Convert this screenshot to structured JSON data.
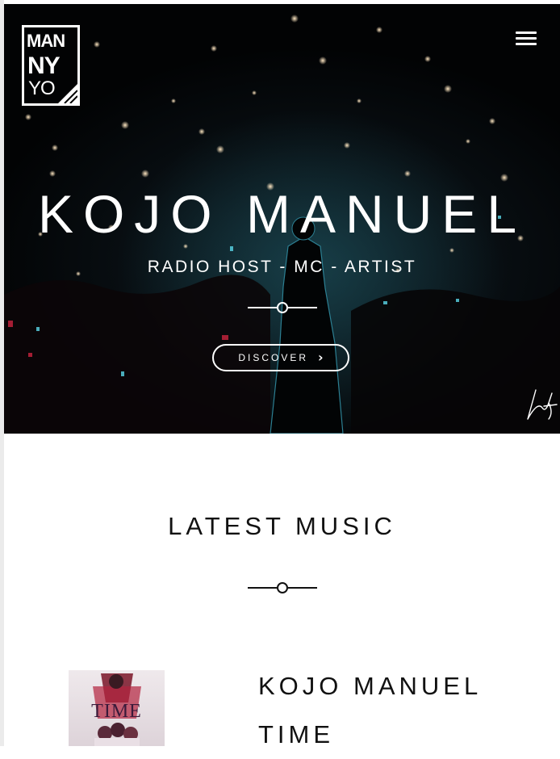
{
  "logo": {
    "line1": "MAN",
    "line2": "NY",
    "line3": "YO"
  },
  "hero": {
    "title": "KOJO MANUEL",
    "subtitle": "RADIO HOST - MC - ARTIST",
    "discover_label": "DISCOVER"
  },
  "icons": {
    "menu": "hamburger-menu-icon",
    "discover": "chevron-right-icon",
    "divider": "circle-line-divider-icon",
    "signature": "signature-mark"
  },
  "colors": {
    "hero_bg": "#05080a",
    "text_light": "#ffffff",
    "text_dark": "#111111"
  },
  "music": {
    "section_title": "LATEST MUSIC",
    "items": [
      {
        "title_line1": "KOJO MANUEL",
        "title_line2": "TIME",
        "cover_word": "TIME"
      }
    ]
  }
}
